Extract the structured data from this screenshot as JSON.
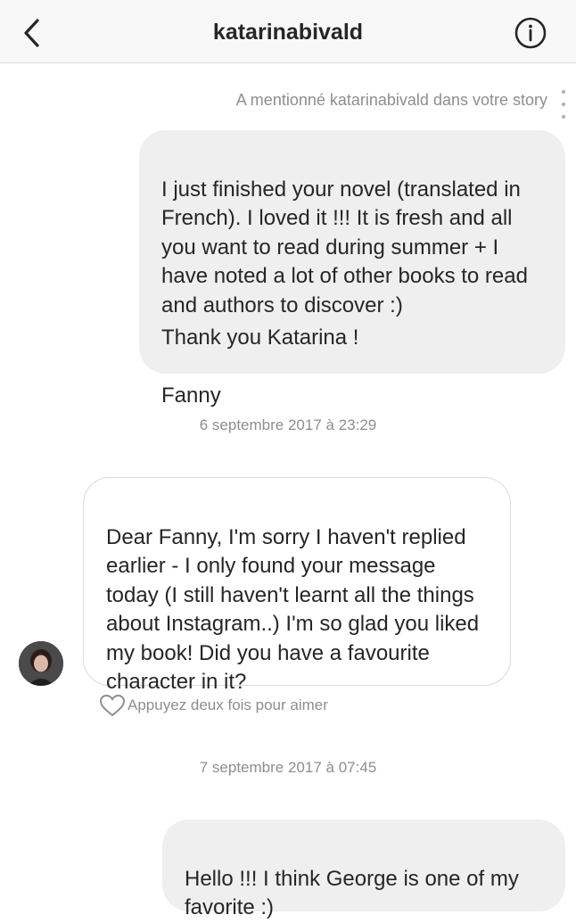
{
  "header": {
    "title": "katarinabivald",
    "back_icon": "chevron-left-icon",
    "info_icon": "info-circle-icon"
  },
  "thread": {
    "mention_note": "A mentionné katarinabivald dans votre story",
    "messages": [
      {
        "direction": "outgoing",
        "paragraph": "I just finished your novel (translated in French). I loved it !!! It is fresh and all you want to read during summer + I have noted a lot of other books to read and authors to discover :)",
        "line2": "Thank you Katarina !",
        "line3": "Fanny"
      },
      {
        "direction": "incoming",
        "text": "Dear Fanny, I'm sorry I haven't replied earlier - I only found your message today (I still haven't learnt all the things about Instagram..) I'm so glad you liked my book! Did you have a favourite character in it?"
      },
      {
        "direction": "outgoing",
        "text": "Hello !!! I think George is one of my favorite :)"
      }
    ],
    "timestamps": [
      "6 septembre 2017 à 23:29",
      "7 septembre 2017 à 07:45"
    ],
    "like_hint": "Appuyez deux fois pour aimer"
  },
  "colors": {
    "header_bg": "#f8f8f8",
    "outgoing_bubble": "#efefef",
    "incoming_border": "#dbdbdb",
    "meta_text": "#8e8e8e"
  }
}
